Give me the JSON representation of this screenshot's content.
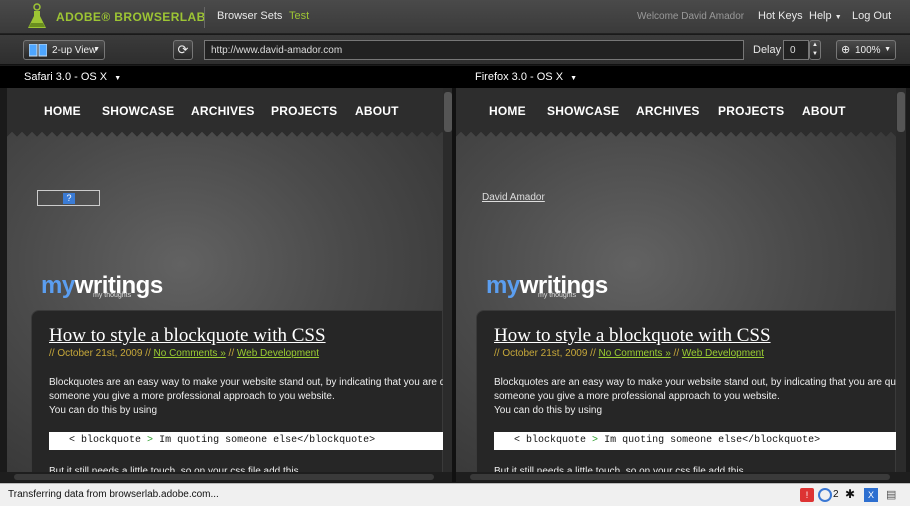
{
  "header": {
    "brand": "ADOBE® BROWSERLAB",
    "browser_sets": "Browser Sets",
    "test": "Test",
    "welcome": "Welcome David Amador",
    "hot_keys": "Hot Keys",
    "help": "Help",
    "log_out": "Log Out"
  },
  "toolbar": {
    "view_mode": "2-up View",
    "url": "http://www.david-amador.com",
    "delay_label": "Delay",
    "delay_value": "0",
    "zoom": "100%"
  },
  "browsers": [
    {
      "name": "Safari 3.0 - OS X"
    },
    {
      "name": "Firefox 3.0 - OS X"
    }
  ],
  "site": {
    "nav": [
      "HOME",
      "SHOWCASE",
      "ARCHIVES",
      "PROJECTS",
      "ABOUT"
    ],
    "logo_my": "my",
    "logo_writings": "writings",
    "logo_tagline": "my thoughts",
    "author_link": "David Amador",
    "post_title": "How to style a blockquote with CSS",
    "post_date": "// October 21st, 2009 //",
    "post_comments": "No Comments »",
    "post_sep": "//",
    "post_category": "Web Development",
    "p1a": "Blockquotes are an easy way to make your website stand out, by indicating that you are quoting",
    "p1b": "someone you give a more professional approach to you website.",
    "p1c": "You can do this by using",
    "code_a": "< blockquote",
    "code_b": ">",
    "code_c": "Im quoting someone else</blockquote>",
    "p2": "But it still needs a little touch, so on your css file add this"
  },
  "status": {
    "text": "Transferring data from browserlab.adobe.com...",
    "count": "2"
  },
  "colors": {
    "brand": "#9dc534",
    "accent_blue": "#5b9ef0",
    "meta_gold": "#c8a93a",
    "link_green": "#9acd32"
  }
}
